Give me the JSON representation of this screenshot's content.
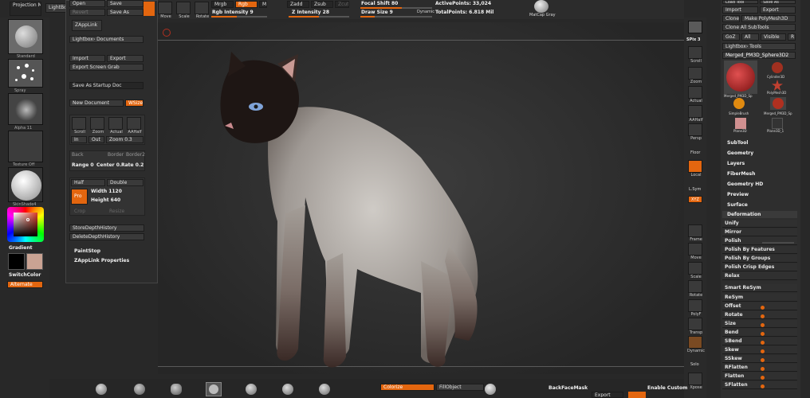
{
  "top_left": {
    "projection_master": "Projection Master",
    "lightbox": "LightBox",
    "open": "Open",
    "save": "Save",
    "revert": "Revert",
    "save_as": "Save As",
    "zapplink": "ZAppLink",
    "lightbox_documents": "Lightbox› Documents",
    "import": "Import",
    "export": "Export",
    "export_screen_grab": "Export Screen Grab",
    "save_as_startup_doc": "Save As Startup Doc",
    "new_document": "New Document",
    "wsize": "WSize",
    "scroll": "Scroll",
    "zoom": "Zoom",
    "actual": "Actual",
    "aahalf": "AAHalf",
    "in": "In",
    "out": "Out",
    "zoom_value": "Zoom 0.3",
    "back": "Back",
    "border": "Border",
    "border2": "Border2",
    "range": "Range 0",
    "center": "Center 0.",
    "rate": "Rate 0.2",
    "half": "Half",
    "double": "Double",
    "pro": "Pro",
    "width": "Width 1120",
    "height": "Height 640",
    "crop": "Crop",
    "resize": "Resize",
    "store_depth_history": "StoreDepthHistory",
    "delete_depth_history": "DeleteDepthHistory",
    "paintstop": "PaintStop",
    "zapplink_properties": "ZAppLink Properties"
  },
  "left_shelf": {
    "brush_label": "Standard",
    "stroke_label": "Spray",
    "alpha_label": "Alpha 11",
    "texture_label": "Texture Off",
    "material_label": "SkinShade4",
    "gradient": "Gradient",
    "switchcolor": "SwitchColor",
    "alternate": "Alternate"
  },
  "top_bar": {
    "move": "Move",
    "scale": "Scale",
    "rotate": "Rotate",
    "mrgb": "Mrgb",
    "rgb": "Rgb",
    "m": "M",
    "rgb_intensity": "Rgb Intensity 9",
    "zadd": "Zadd",
    "zsub": "Zsub",
    "zcut": "Zcut",
    "z_intensity": "Z Intensity 28",
    "focal_shift": "Focal Shift 80",
    "draw_size": "Draw Size 9",
    "dynamic": "Dynamic",
    "active_points": "ActivePoints: 33,024",
    "total_points": "TotalPoints: 6.818 Mil",
    "matcap_gray": "MatCap Gray"
  },
  "right_toolbar": {
    "spix": "SPix 3",
    "scroll": "Scroll",
    "zoom": "Zoom",
    "actual": "Actual",
    "aahalf": "AAHalf",
    "persp": "Persp",
    "floor": "Floor",
    "local": "Local",
    "lsym": "L.Sym",
    "xyz": "XYZ",
    "frame": "Frame",
    "move": "Move",
    "scale": "Scale",
    "rotate": "Rotate",
    "polyf": "PolyF",
    "transp": "Transp",
    "dynamic": "Dynamic",
    "solo": "Solo",
    "xpose": "Xpose"
  },
  "tool_panel": {
    "load_tool": "Load Tool",
    "save_as": "Save As",
    "import": "Import",
    "export": "Export",
    "clone": "Clone",
    "make_polymesh": "Make PolyMesh3D",
    "clone_all_subtools": "Clone All SubTools",
    "goz": "GoZ",
    "all": "All",
    "visible": "Visible",
    "r": "R",
    "lightbox_tools": "Lightbox› Tools",
    "current_tool": "Merged_PM3D_Sphere3D2",
    "thumbs": [
      "Merged_PM3D_Sp",
      "Cylinder3D",
      "SimpleBrush",
      "PolyMesh3D",
      "Merged_PM3D_Sp",
      "Plane3D",
      "Plane3D_1"
    ],
    "sections": [
      "SubTool",
      "Geometry",
      "Layers",
      "FiberMesh",
      "Geometry HD",
      "Preview",
      "Surface"
    ],
    "deformation": "Deformation",
    "deform_rows": [
      "Unify",
      "Mirror",
      "Polish",
      "Polish By Features",
      "Polish By Groups",
      "Polish Crisp Edges",
      "Relax",
      "Smart ReSym",
      "ReSym",
      "Offset",
      "Rotate",
      "Size",
      "Bend",
      "SBend",
      "Skew",
      "SSkew",
      "RFlatten",
      "Flatten",
      "SFlatten"
    ]
  },
  "bottom_bar": {
    "colorize": "Colorize",
    "fillobject": "FillObject",
    "backfacemask": "BackFaceMask",
    "enable_custom": "Enable Custom",
    "export": "Export"
  },
  "colors": {
    "accent": "#e3660f",
    "background": "#282828",
    "panel": "#303030",
    "secondary_color": "#caa393"
  }
}
